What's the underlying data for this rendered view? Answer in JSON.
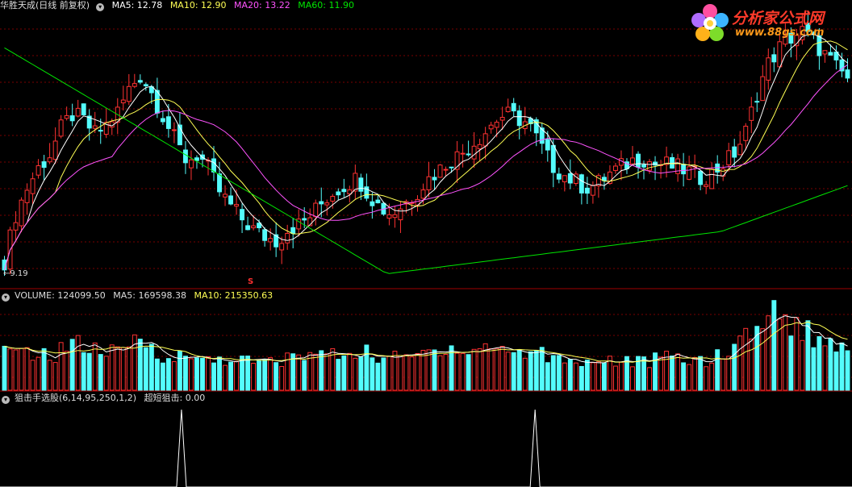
{
  "header_price": {
    "name": "华胜天成(日线 前复权)",
    "ma5": "MA5: 12.78",
    "ma10": "MA10: 12.90",
    "ma20": "MA20: 13.22",
    "ma60": "MA60: 11.90"
  },
  "header_volume": {
    "volume": "VOLUME: 124099.50",
    "ma5": "MA5: 169598.38",
    "ma10": "MA10: 215350.63"
  },
  "header_indicator": {
    "name": "狙击手选股(6,14,95,250,1,2)",
    "value": "超短狙击: 0.00"
  },
  "low_marker": "←9.19",
  "signal_marker": "S",
  "logo": {
    "title": "分析家公式网",
    "url": "www.88gs.com"
  },
  "colors": {
    "up": "#ff3232",
    "down": "#54fcfc",
    "ma5": "#ffffff",
    "ma10": "#ffff54",
    "ma20": "#ff54ff",
    "ma60": "#00e600",
    "grid": "#7a0000",
    "indicator": "#ffffff"
  },
  "chart_data": {
    "type": "candlestick",
    "price_range": [
      9.0,
      16.8
    ],
    "close_series": [
      9.4,
      10.8,
      11.6,
      12.2,
      12.6,
      13.4,
      13.8,
      13.6,
      13.2,
      13.5,
      13.9,
      14.6,
      15.0,
      14.4,
      13.7,
      13.0,
      12.4,
      12.6,
      12.1,
      11.4,
      11.0,
      10.6,
      10.3,
      10.1,
      10.0,
      10.4,
      10.5,
      10.8,
      11.2,
      11.5,
      11.7,
      11.9,
      11.4,
      11.0,
      10.8,
      11.1,
      11.4,
      11.8,
      12.1,
      12.4,
      12.6,
      12.9,
      13.2,
      13.6,
      13.8,
      13.7,
      13.5,
      12.9,
      12.3,
      12.0,
      11.8,
      11.6,
      11.7,
      12.0,
      12.2,
      12.4,
      12.5,
      12.3,
      12.3,
      12.2,
      12.1,
      11.9,
      12.0,
      12.3,
      12.6,
      13.2,
      14.4,
      15.3,
      15.8,
      16.1,
      16.3,
      16.0,
      15.6,
      15.2,
      14.9
    ],
    "volume_range": [
      0,
      420000
    ],
    "volumes": [
      180000,
      160000,
      190000,
      175000,
      140000,
      210000,
      230000,
      200000,
      190000,
      180000,
      170000,
      200000,
      260000,
      190000,
      170000,
      150000,
      160000,
      140000,
      155000,
      145000,
      150000,
      140000,
      130000,
      130000,
      140000,
      150000,
      160000,
      170000,
      180000,
      160000,
      175000,
      190000,
      170000,
      160000,
      150000,
      155000,
      160000,
      180000,
      200000,
      210000,
      195000,
      185000,
      200000,
      210000,
      190000,
      180000,
      175000,
      185000,
      150000,
      160000,
      140000,
      130000,
      135000,
      150000,
      140000,
      135000,
      130000,
      145000,
      150000,
      155000,
      140000,
      150000,
      145000,
      160000,
      200000,
      260000,
      340000,
      300000,
      410000,
      330000,
      280000,
      260000,
      230000,
      220000,
      200000
    ],
    "indicator_name": "超短狙击",
    "indicator_values": [
      0,
      0,
      0,
      0,
      0,
      0,
      0,
      0,
      0,
      0,
      0,
      0,
      0,
      0,
      0,
      0,
      0,
      0,
      0,
      0,
      0,
      0,
      0,
      0,
      0,
      0,
      0,
      0,
      0,
      0,
      0,
      0,
      0,
      0,
      0,
      0,
      0,
      0,
      0,
      0,
      0,
      0,
      0,
      0,
      0,
      0,
      0,
      0,
      0,
      0,
      0,
      0,
      0,
      0,
      0,
      0,
      0,
      0,
      0,
      0,
      0,
      0,
      0,
      0,
      0,
      0,
      0,
      0,
      0,
      0,
      0,
      0,
      0,
      0,
      0
    ],
    "indicator_spike_positions": [
      0.213,
      0.628
    ],
    "low_value": 9.19
  }
}
